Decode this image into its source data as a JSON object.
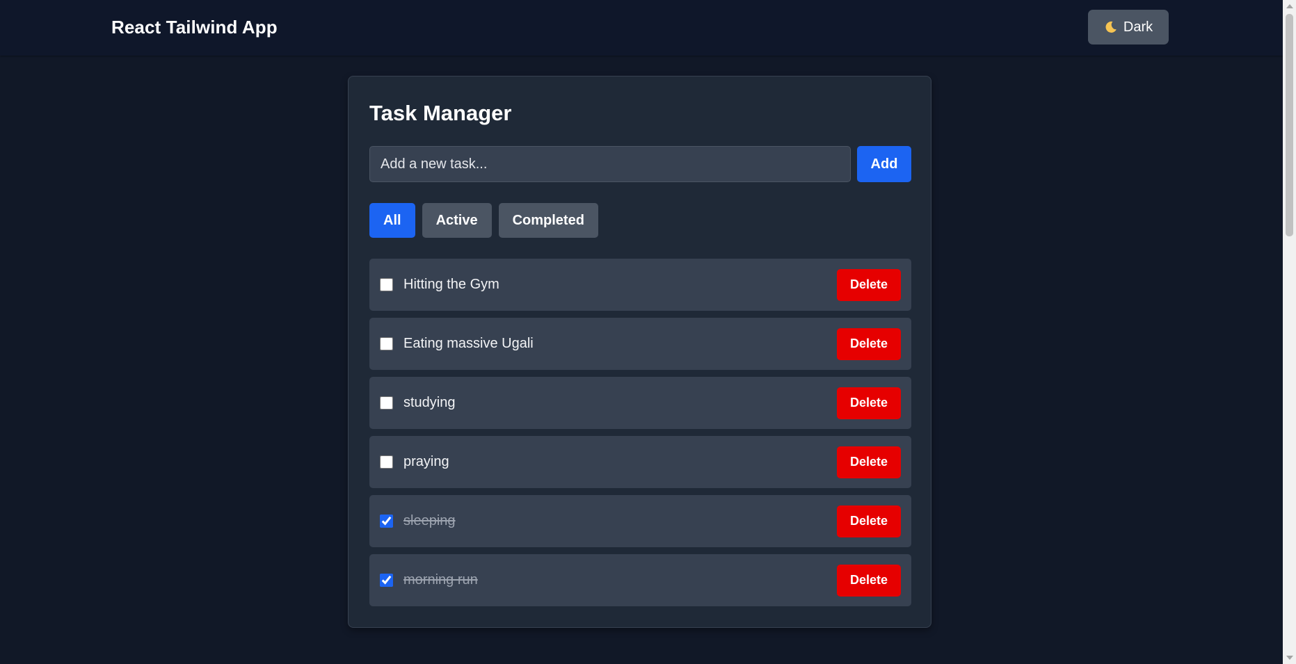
{
  "navbar": {
    "brand": "React Tailwind App",
    "theme_toggle": {
      "icon": "moon-icon",
      "label": "Dark"
    }
  },
  "task_manager": {
    "title": "Task Manager",
    "input": {
      "placeholder": "Add a new task...",
      "value": ""
    },
    "add_label": "Add",
    "filters": [
      {
        "label": "All",
        "active": true
      },
      {
        "label": "Active",
        "active": false
      },
      {
        "label": "Completed",
        "active": false
      }
    ],
    "tasks": [
      {
        "text": "Hitting the Gym",
        "completed": false,
        "delete_label": "Delete"
      },
      {
        "text": "Eating massive Ugali",
        "completed": false,
        "delete_label": "Delete"
      },
      {
        "text": "studying",
        "completed": false,
        "delete_label": "Delete"
      },
      {
        "text": "praying",
        "completed": false,
        "delete_label": "Delete"
      },
      {
        "text": "sleeping",
        "completed": true,
        "delete_label": "Delete"
      },
      {
        "text": "morning run",
        "completed": true,
        "delete_label": "Delete"
      }
    ]
  },
  "colors": {
    "background": "#111827",
    "navbar": "#0f172a",
    "card": "#1f2937",
    "row": "#374151",
    "primary": "#1c64f2",
    "danger": "#e60000",
    "secondary": "#4b5563"
  }
}
